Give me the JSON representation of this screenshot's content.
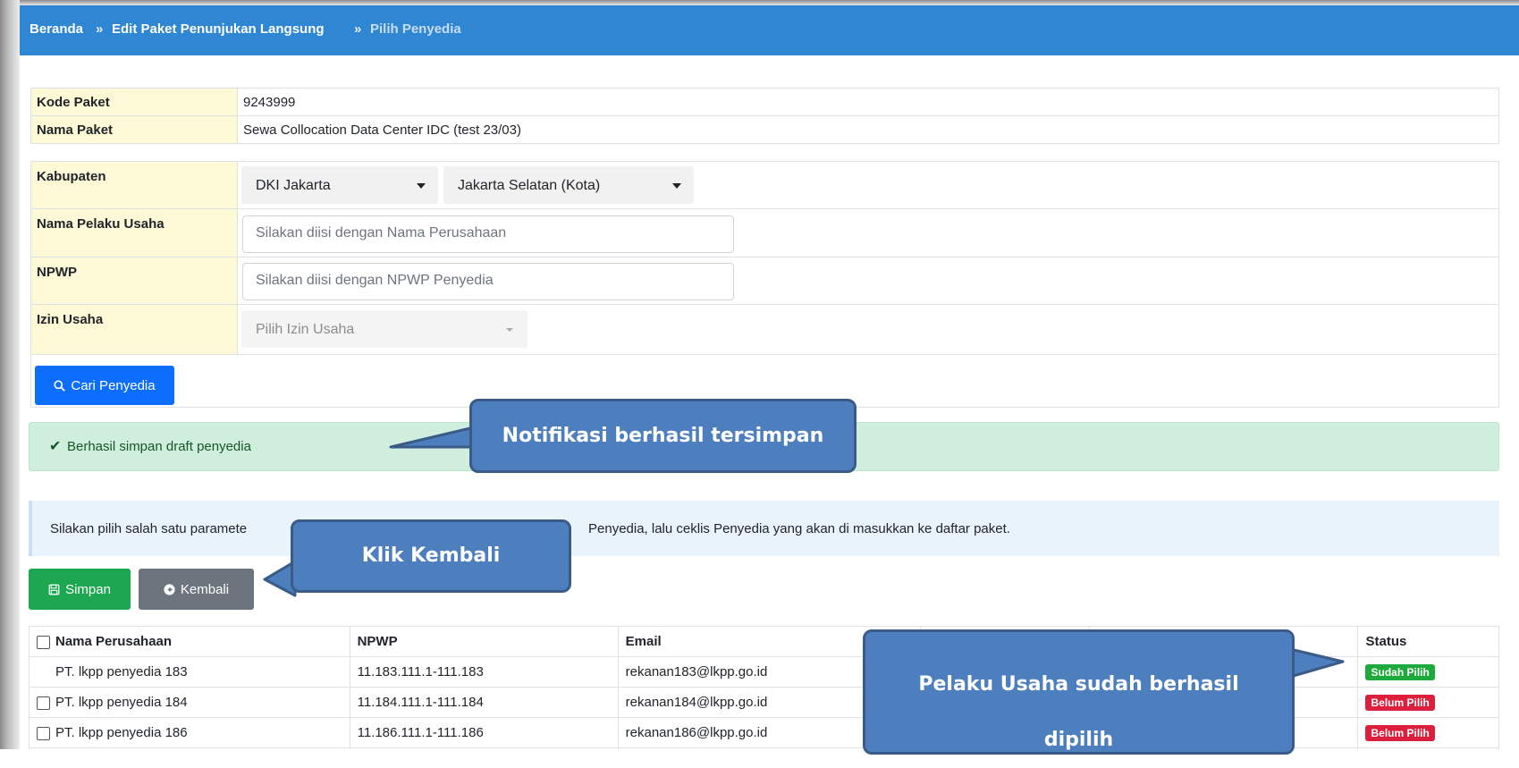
{
  "breadcrumb": {
    "home": "Beranda",
    "separator": "»",
    "edit": "Edit Paket Penunjukan Langsung",
    "current": "Pilih Penyedia"
  },
  "paket": {
    "kode_label": "Kode Paket",
    "kode_value": "9243999",
    "nama_label": "Nama Paket",
    "nama_value": "Sewa Collocation Data Center IDC (test 23/03)"
  },
  "search_form": {
    "kabupaten_label": "Kabupaten",
    "provinsi_selected": "DKI Jakarta",
    "kota_selected": "Jakarta Selatan (Kota)",
    "nama_label": "Nama Pelaku Usaha",
    "nama_placeholder": "Silakan diisi dengan Nama Perusahaan",
    "npwp_label": "NPWP",
    "npwp_placeholder": "Silakan diisi dengan NPWP Penyedia",
    "izin_label": "Izin Usaha",
    "izin_placeholder": "Pilih Izin Usaha",
    "cari_button": "Cari Penyedia"
  },
  "alert_success": "Berhasil simpan draft penyedia",
  "info_text_start": "Silakan pilih salah satu paramete",
  "info_text_end": "Penyedia, lalu ceklis Penyedia yang akan di masukkan ke daftar paket.",
  "actions": {
    "simpan": "Simpan",
    "kembali": "Kembali"
  },
  "table": {
    "headers": [
      "Nama Perusahaan",
      "NPWP",
      "Email",
      "Status"
    ],
    "rows": [
      {
        "nama": "PT. lkpp penyedia 183",
        "npwp": "11.183.111.1-111.183",
        "email": "rekanan183@lkpp.go.id",
        "status": "Sudah Pilih",
        "checkbox": false
      },
      {
        "nama": "PT. lkpp penyedia 184",
        "npwp": "11.184.111.1-111.184",
        "email": "rekanan184@lkpp.go.id",
        "status": "Belum Pilih",
        "checkbox": true
      },
      {
        "nama": "PT. lkpp penyedia 186",
        "npwp": "11.186.111.1-111.186",
        "email": "rekanan186@lkpp.go.id",
        "status": "Belum Pilih",
        "checkbox": true
      }
    ]
  },
  "callouts": {
    "notif": "Notifikasi berhasil tersimpan",
    "kembali": "Klik Kembali",
    "status_line1": "Pelaku Usaha sudah berhasil",
    "status_line2": "dipilih"
  },
  "colors": {
    "header_bar": "#2f86d2",
    "label_bg": "#fdf8d6",
    "primary": "#0d6efd",
    "success": "#1ea751",
    "secondary": "#6c757d",
    "alert_success_bg": "#cfeedd",
    "info_bg": "#e9f3fb",
    "badge_green": "#1eaa3a",
    "badge_red": "#dc1f3c",
    "callout": "#4d7fbe"
  }
}
